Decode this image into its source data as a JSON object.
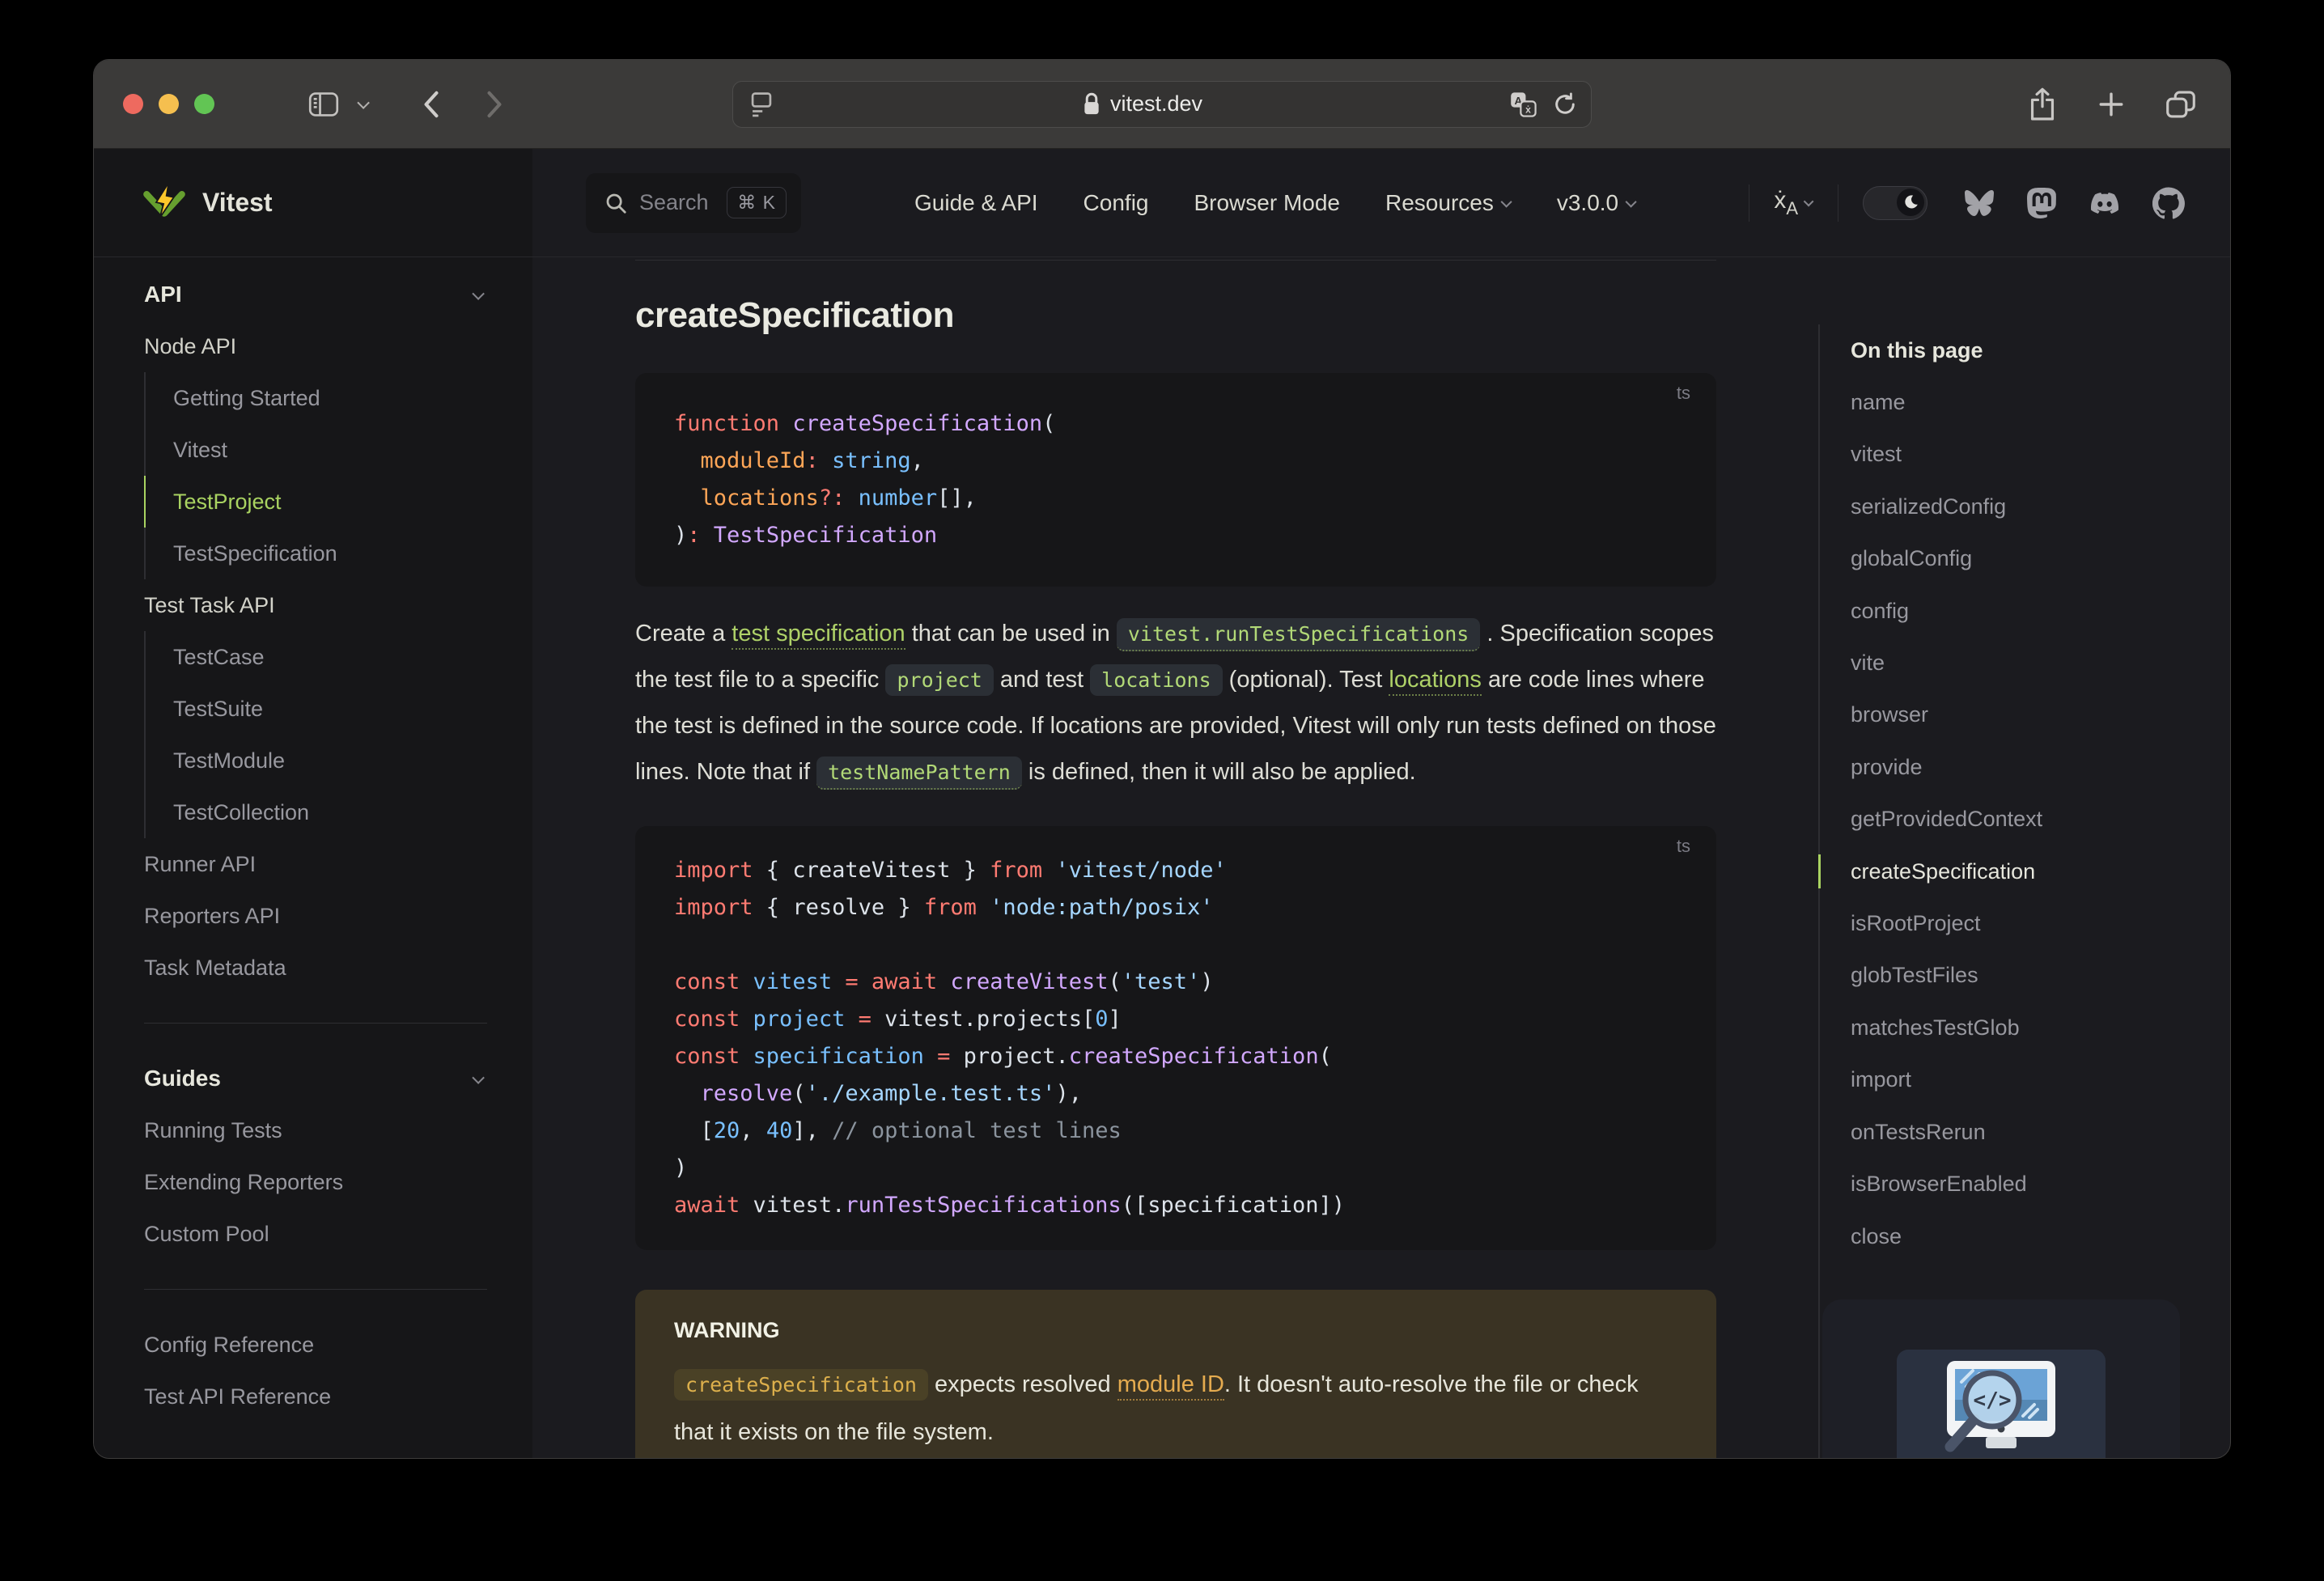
{
  "chrome": {
    "url": "vitest.dev",
    "icons": [
      "close",
      "minimize",
      "zoom",
      "sidebar-toggle",
      "chevron-down",
      "back",
      "forward",
      "reader-view",
      "lock",
      "translate",
      "reload",
      "share",
      "new-tab",
      "tab-overview"
    ]
  },
  "nav": {
    "logo_text": "Vitest",
    "search": {
      "label": "Search",
      "kbd": "⌘ K"
    },
    "links": [
      {
        "label": "Guide & API",
        "chevron": false
      },
      {
        "label": "Config",
        "chevron": false
      },
      {
        "label": "Browser Mode",
        "chevron": false
      },
      {
        "label": "Resources",
        "chevron": true
      },
      {
        "label": "v3.0.0",
        "chevron": true
      }
    ],
    "icons": [
      "language",
      "theme-toggle-moon",
      "bluesky",
      "mastodon",
      "discord",
      "github"
    ]
  },
  "sidebar": {
    "groups": [
      {
        "type": "section",
        "label": "API",
        "chevron": true,
        "items": [
          {
            "label": "Node API",
            "cls": "strong"
          },
          {
            "label": "Getting Started",
            "indent": true
          },
          {
            "label": "Vitest",
            "indent": true
          },
          {
            "label": "TestProject",
            "indent": true,
            "active": true
          },
          {
            "label": "TestSpecification",
            "indent": true
          },
          {
            "label": "Test Task API",
            "cls": "strong"
          },
          {
            "label": "TestCase",
            "indent": true
          },
          {
            "label": "TestSuite",
            "indent": true
          },
          {
            "label": "TestModule",
            "indent": true
          },
          {
            "label": "TestCollection",
            "indent": true
          },
          {
            "label": "Runner API"
          },
          {
            "label": "Reporters API"
          },
          {
            "label": "Task Metadata"
          }
        ]
      },
      {
        "type": "divider"
      },
      {
        "type": "section",
        "label": "Guides",
        "chevron": true,
        "items": [
          {
            "label": "Running Tests"
          },
          {
            "label": "Extending Reporters"
          },
          {
            "label": "Custom Pool"
          }
        ]
      },
      {
        "type": "divider"
      },
      {
        "type": "plain",
        "items": [
          {
            "label": "Config Reference"
          },
          {
            "label": "Test API Reference"
          }
        ]
      }
    ]
  },
  "doc": {
    "title": "createSpecification",
    "code1": {
      "lang": "ts",
      "lines": [
        [
          [
            "k",
            "function"
          ],
          [
            "p",
            " "
          ],
          [
            "f",
            "createSpecification"
          ],
          [
            "p",
            "("
          ]
        ],
        [
          [
            "p",
            "  "
          ],
          [
            "o",
            "moduleId"
          ],
          [
            "k",
            ":"
          ],
          [
            "p",
            " "
          ],
          [
            "t",
            "string"
          ],
          [
            "p",
            ","
          ]
        ],
        [
          [
            "p",
            "  "
          ],
          [
            "o",
            "locations"
          ],
          [
            "k",
            "?:"
          ],
          [
            "p",
            " "
          ],
          [
            "t",
            "number"
          ],
          [
            "p",
            "[],"
          ]
        ],
        [
          [
            "p",
            ")"
          ],
          [
            "k",
            ":"
          ],
          [
            "p",
            " "
          ],
          [
            "f",
            "TestSpecification"
          ]
        ]
      ]
    },
    "paragraph": [
      {
        "t": "Create a ",
        "s": "plain"
      },
      {
        "t": "test specification",
        "s": "link"
      },
      {
        "t": " that can be used in ",
        "s": "plain"
      },
      {
        "t": "vitest.runTestSpecifications",
        "s": "codelink"
      },
      {
        "t": " . Specification scopes the test file to a specific ",
        "s": "plain"
      },
      {
        "t": "project",
        "s": "code"
      },
      {
        "t": " and test ",
        "s": "plain"
      },
      {
        "t": "locations",
        "s": "code"
      },
      {
        "t": " (optional). Test ",
        "s": "plain"
      },
      {
        "t": "locations",
        "s": "link"
      },
      {
        "t": " are code lines where the test is defined in the source code. If locations are provided, Vitest will only run tests defined on those lines. Note that if ",
        "s": "plain"
      },
      {
        "t": "testNamePattern",
        "s": "codelink"
      },
      {
        "t": " is defined, then it will also be applied.",
        "s": "plain"
      }
    ],
    "code2": {
      "lang": "ts",
      "lines": [
        [
          [
            "k",
            "import"
          ],
          [
            "p",
            " { createVitest } "
          ],
          [
            "k",
            "from"
          ],
          [
            "p",
            " "
          ],
          [
            "s",
            "'vitest/node'"
          ]
        ],
        [
          [
            "k",
            "import"
          ],
          [
            "p",
            " { resolve } "
          ],
          [
            "k",
            "from"
          ],
          [
            "p",
            " "
          ],
          [
            "s",
            "'node:path/posix'"
          ]
        ],
        [],
        [
          [
            "k",
            "const"
          ],
          [
            "p",
            " "
          ],
          [
            "t",
            "vitest"
          ],
          [
            "p",
            " "
          ],
          [
            "k",
            "="
          ],
          [
            "p",
            " "
          ],
          [
            "k",
            "await"
          ],
          [
            "p",
            " "
          ],
          [
            "f",
            "createVitest"
          ],
          [
            "p",
            "("
          ],
          [
            "s",
            "'test'"
          ],
          [
            "p",
            ")"
          ]
        ],
        [
          [
            "k",
            "const"
          ],
          [
            "p",
            " "
          ],
          [
            "t",
            "project"
          ],
          [
            "p",
            " "
          ],
          [
            "k",
            "="
          ],
          [
            "p",
            " vitest.projects["
          ],
          [
            "t",
            "0"
          ],
          [
            "p",
            "]"
          ]
        ],
        [
          [
            "k",
            "const"
          ],
          [
            "p",
            " "
          ],
          [
            "t",
            "specification"
          ],
          [
            "p",
            " "
          ],
          [
            "k",
            "="
          ],
          [
            "p",
            " project."
          ],
          [
            "f",
            "createSpecification"
          ],
          [
            "p",
            "("
          ]
        ],
        [
          [
            "p",
            "  "
          ],
          [
            "f",
            "resolve"
          ],
          [
            "p",
            "("
          ],
          [
            "s",
            "'./example.test.ts'"
          ],
          [
            "p",
            "),"
          ]
        ],
        [
          [
            "p",
            "  ["
          ],
          [
            "t",
            "20"
          ],
          [
            "p",
            ", "
          ],
          [
            "t",
            "40"
          ],
          [
            "p",
            "], "
          ],
          [
            "c",
            "// optional test lines"
          ]
        ],
        [
          [
            "p",
            ")"
          ]
        ],
        [
          [
            "k",
            "await"
          ],
          [
            "p",
            " vitest."
          ],
          [
            "f",
            "runTestSpecifications"
          ],
          [
            "p",
            "([specification])"
          ]
        ]
      ]
    },
    "warning": {
      "title": "WARNING",
      "body": [
        {
          "t": "createSpecification",
          "s": "warnchip"
        },
        {
          "t": " expects resolved ",
          "s": "plain"
        },
        {
          "t": "module ID",
          "s": "warnlink"
        },
        {
          "t": ". It doesn't auto-resolve the file or check that it exists on the file system.",
          "s": "plain"
        }
      ]
    }
  },
  "outline": {
    "title": "On this page",
    "items": [
      {
        "label": "name"
      },
      {
        "label": "vitest"
      },
      {
        "label": "serializedConfig"
      },
      {
        "label": "globalConfig"
      },
      {
        "label": "config"
      },
      {
        "label": "vite"
      },
      {
        "label": "browser"
      },
      {
        "label": "provide"
      },
      {
        "label": "getProvidedContext"
      },
      {
        "label": "createSpecification",
        "active": true
      },
      {
        "label": "isRootProject"
      },
      {
        "label": "globTestFiles"
      },
      {
        "label": "matchesTestGlob"
      },
      {
        "label": "import"
      },
      {
        "label": "onTestsRerun"
      },
      {
        "label": "isBrowserEnabled"
      },
      {
        "label": "close"
      }
    ]
  },
  "colors": {
    "brand_green": "#a9d361",
    "logo_yellow": "#fcc72b",
    "logo_green": "#669f2f",
    "bg_page": "#1b1b1f",
    "bg_alt": "#161618",
    "warning_bg": "#3a3323",
    "code_keyword": "#ff7b72",
    "code_function": "#d2a8ff",
    "code_const": "#79c0ff",
    "code_string": "#a5d6ff",
    "code_property": "#ffa657",
    "code_comment": "#8b949e"
  }
}
